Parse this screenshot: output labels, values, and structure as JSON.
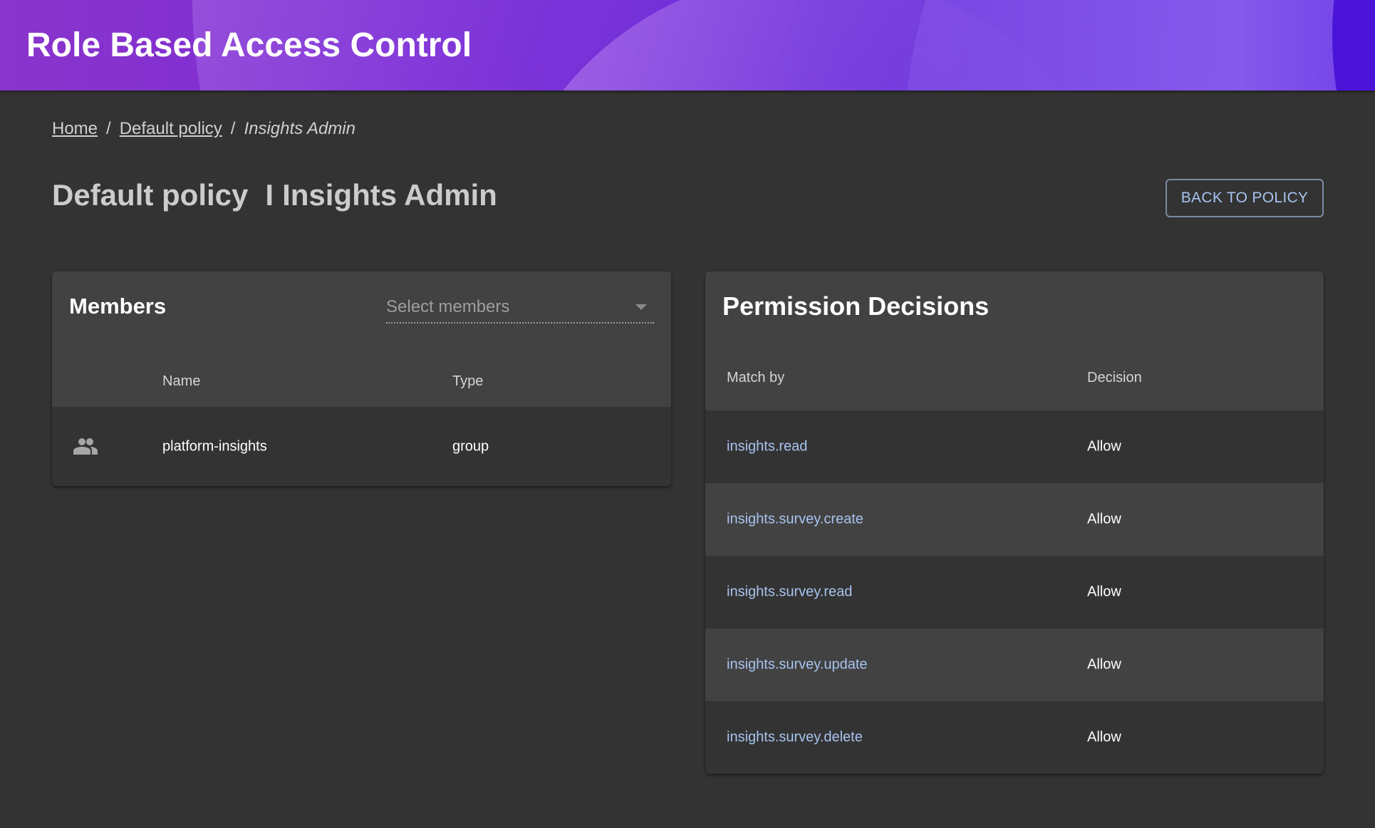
{
  "app": {
    "title": "Role Based Access Control"
  },
  "breadcrumb": {
    "items": [
      {
        "label": "Home"
      },
      {
        "label": "Default policy"
      }
    ],
    "separator": "/",
    "current": "Insights Admin"
  },
  "page": {
    "policy_name": "Default policy",
    "divider": "I",
    "role_name": "Insights Admin",
    "back_button_label": "BACK TO POLICY"
  },
  "members": {
    "title": "Members",
    "select_placeholder": "Select members",
    "columns": [
      "Name",
      "Type"
    ],
    "rows": [
      {
        "icon": "group-icon",
        "name": "platform-insights",
        "type": "group"
      }
    ]
  },
  "permissions": {
    "title": "Permission Decisions",
    "columns": [
      "Match by",
      "Decision"
    ],
    "rows": [
      {
        "match": "insights.read",
        "decision": "Allow"
      },
      {
        "match": "insights.survey.create",
        "decision": "Allow"
      },
      {
        "match": "insights.survey.read",
        "decision": "Allow"
      },
      {
        "match": "insights.survey.update",
        "decision": "Allow"
      },
      {
        "match": "insights.survey.delete",
        "decision": "Allow"
      }
    ]
  },
  "colors": {
    "background": "#333333",
    "panel_header": "#424242",
    "link": "#a8c4f0",
    "header_gradient_start": "#8a35cc",
    "header_gradient_end": "#5a1ee0"
  }
}
